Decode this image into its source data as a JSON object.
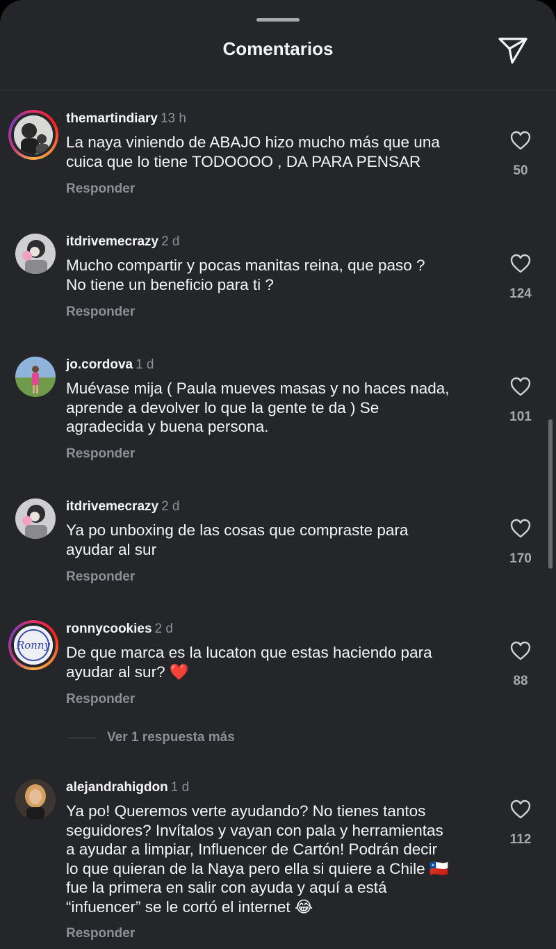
{
  "header": {
    "title": "Comentarios",
    "share_icon": "send-icon"
  },
  "reply_label": "Responder",
  "more_replies": "Ver 1 respuesta más",
  "comments": [
    {
      "username": "themartindiary",
      "time": "13 h",
      "text": "La naya viniendo de ABAJO hizo mucho más que una\ncuica que lo tiene TODOOOO , DA PARA PENSAR",
      "likes": "50",
      "story_ring": true
    },
    {
      "username": "itdrivemecrazy",
      "time": "2 d",
      "text": "Mucho compartir y pocas manitas reina, que paso ?\nNo tiene un beneficio para ti ?",
      "likes": "124",
      "story_ring": false
    },
    {
      "username": "jo.cordova",
      "time": "1 d",
      "text": "Muévase mija ( Paula mueves masas y no haces nada,\naprende a devolver lo que la gente te da ) Se\nagradecida y buena persona.",
      "likes": "101",
      "story_ring": false
    },
    {
      "username": "itdrivemecrazy",
      "time": "2 d",
      "text": "Ya po unboxing de las cosas que compraste para\nayudar al sur",
      "likes": "170",
      "story_ring": false
    },
    {
      "username": "ronnycookies",
      "time": "2 d",
      "text": "De que marca es la lucaton que estas haciendo para\nayudar al sur? ❤️",
      "likes": "88",
      "story_ring": true
    },
    {
      "username": "alejandrahigdon",
      "time": "1 d",
      "text": "Ya po! Queremos verte ayudando? No tienes tantos\nseguidores? Invítalos y vayan con pala y herramientas\na ayudar a limpiar, Influencer de Cartón! Podrán decir\nlo que quieran de la Naya pero ella si quiere a Chile 🇨🇱\nfue la primera en salir con ayuda y aquí a está\n“infuencer” se le cortó el internet 😂",
      "likes": "112",
      "story_ring": false
    }
  ],
  "colors": {
    "background": "#25262a",
    "text": "#f5f5f5",
    "muted": "#8e8f94"
  }
}
